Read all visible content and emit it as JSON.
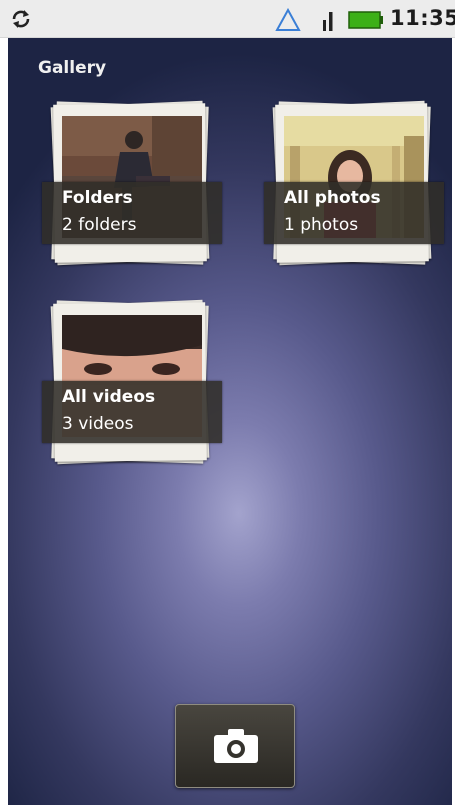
{
  "status_bar": {
    "time": "11:35",
    "icons": [
      "sync-icon",
      "wifi-icon",
      "signal-icon",
      "battery-icon"
    ],
    "battery_color": "#3cb017"
  },
  "screen": {
    "title": "Gallery"
  },
  "albums": [
    {
      "name": "Folders",
      "count": "2 folders",
      "thumbnail": "man-walking-photo"
    },
    {
      "name": "All photos",
      "count": "1 photos",
      "thumbnail": "woman-portrait-photo"
    },
    {
      "name": "All videos",
      "count": "3 videos",
      "thumbnail": "face-closeup-photo"
    }
  ],
  "camera_button": {
    "icon": "camera-icon"
  },
  "colors": {
    "background_center": "#a3a3cd",
    "background_edge": "#1d2444",
    "caption_bg": "#302e28"
  }
}
